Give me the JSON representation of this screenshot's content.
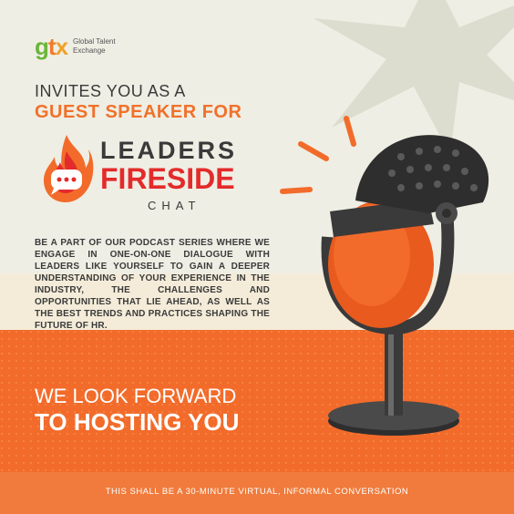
{
  "logo": {
    "mark_letters": [
      "g",
      "t",
      "x"
    ],
    "mark_colors": [
      "#6bb63b",
      "#f07b2a",
      "#f0a12a"
    ],
    "tagline_line1": "Global Talent",
    "tagline_line2": "Exchange"
  },
  "header": {
    "invites": "INVITES YOU AS A",
    "guest": "GUEST SPEAKER FOR"
  },
  "brand": {
    "leaders": "LEADERS",
    "fireside": "FIRESIDE",
    "chat": "CHAT"
  },
  "body": {
    "text": "BE A PART OF OUR PODCAST SERIES WHERE WE ENGAGE IN ONE-ON-ONE DIALOGUE WITH LEADERS LIKE YOURSELF TO GAIN A DEEPER UNDERSTANDING OF YOUR EXPERIENCE IN THE INDUSTRY, THE CHALLENGES AND OPPORTUNITIES THAT LIE AHEAD, AS WELL AS THE BEST TRENDS AND PRACTICES SHAPING THE FUTURE OF HR."
  },
  "cta": {
    "line1": "WE LOOK FORWARD",
    "line2": "TO HOSTING YOU"
  },
  "footer": {
    "text": "THIS SHALL BE A 30-MINUTE VIRTUAL, INFORMAL CONVERSATION"
  },
  "colors": {
    "orange": "#f26b2a",
    "accent_orange": "#f0712a",
    "red": "#e32b2b",
    "dark": "#3a3a3a",
    "cream": "#efeee4"
  }
}
